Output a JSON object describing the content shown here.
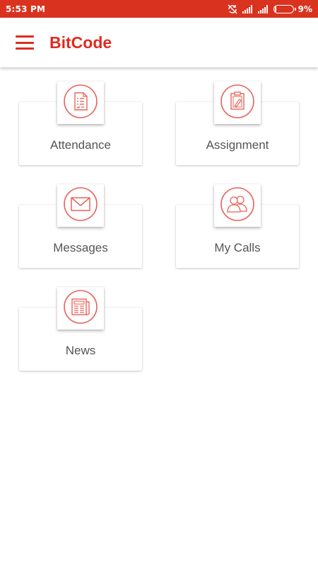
{
  "status_bar": {
    "time": "5:53 PM",
    "battery_percent_text": "9%",
    "battery_level": 0.09,
    "icons": [
      "sync-off-icon",
      "signal-icon",
      "signal-icon",
      "battery-icon"
    ]
  },
  "app_bar": {
    "title": "BitCode",
    "menu_icon": "hamburger-menu-icon"
  },
  "tiles": [
    {
      "label": "Attendance",
      "icon": "attendance-sheet-icon"
    },
    {
      "label": "Assignment",
      "icon": "clipboard-pencil-icon"
    },
    {
      "label": "Messages",
      "icon": "envelope-icon"
    },
    {
      "label": "My Calls",
      "icon": "contacts-people-icon"
    },
    {
      "label": "News",
      "icon": "newspaper-icon"
    }
  ],
  "colors": {
    "brand": "#e02b20",
    "status_bar": "#d9331f",
    "icon_stroke": "#e8645a",
    "label": "#555555"
  }
}
